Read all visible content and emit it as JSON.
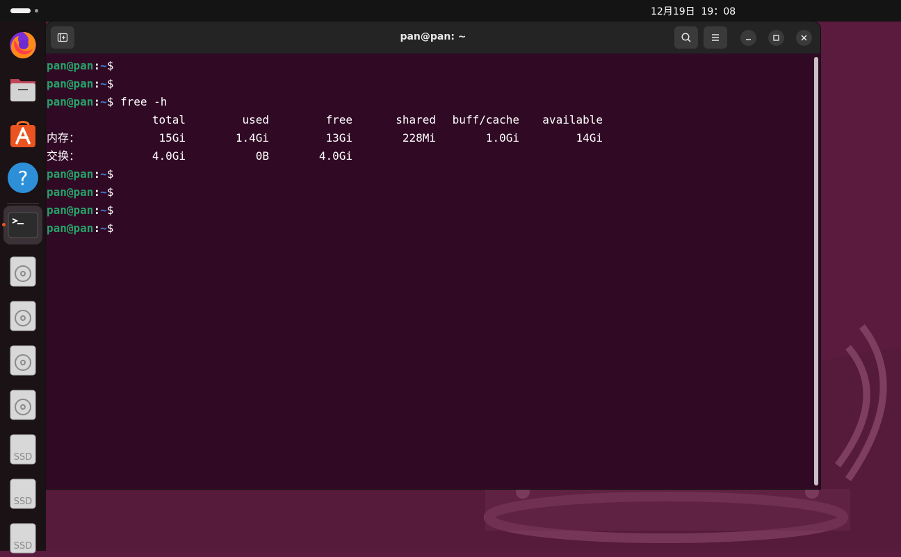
{
  "topbar": {
    "clock": "12月19日  19：08"
  },
  "dock": {
    "items": [
      {
        "name": "firefox-icon"
      },
      {
        "name": "files-icon"
      },
      {
        "name": "app-center-icon"
      },
      {
        "name": "help-icon"
      },
      {
        "name": "terminal-icon",
        "active": true
      },
      {
        "name": "optical-drive-icon"
      },
      {
        "name": "optical-drive-icon"
      },
      {
        "name": "optical-drive-icon"
      },
      {
        "name": "optical-drive-icon"
      },
      {
        "name": "ssd-drive-icon",
        "label": "SSD"
      },
      {
        "name": "ssd-drive-icon",
        "label": "SSD"
      },
      {
        "name": "ssd-drive-icon",
        "label": "SSD"
      }
    ],
    "ssd_label": "SSD"
  },
  "window": {
    "title": "pan@pan: ~"
  },
  "prompt": {
    "user": "pan@pan",
    "colon": ":",
    "path": "~",
    "dollar": "$"
  },
  "terminal": {
    "command": " free -h",
    "free_table": {
      "headers": [
        "total",
        "used",
        "free",
        "shared",
        "buff/cache",
        "available"
      ],
      "rows": [
        {
          "label": "内存：",
          "values": [
            "15Gi",
            "1.4Gi",
            "13Gi",
            "228Mi",
            "1.0Gi",
            "14Gi"
          ]
        },
        {
          "label": "交换：",
          "values": [
            "4.0Gi",
            "0B",
            "4.0Gi",
            "",
            "",
            ""
          ]
        }
      ]
    }
  },
  "colors": {
    "terminal_bg": "#300a24",
    "prompt_user": "#26a269",
    "prompt_path": "#3d7fd8",
    "accent": "#e95420"
  }
}
